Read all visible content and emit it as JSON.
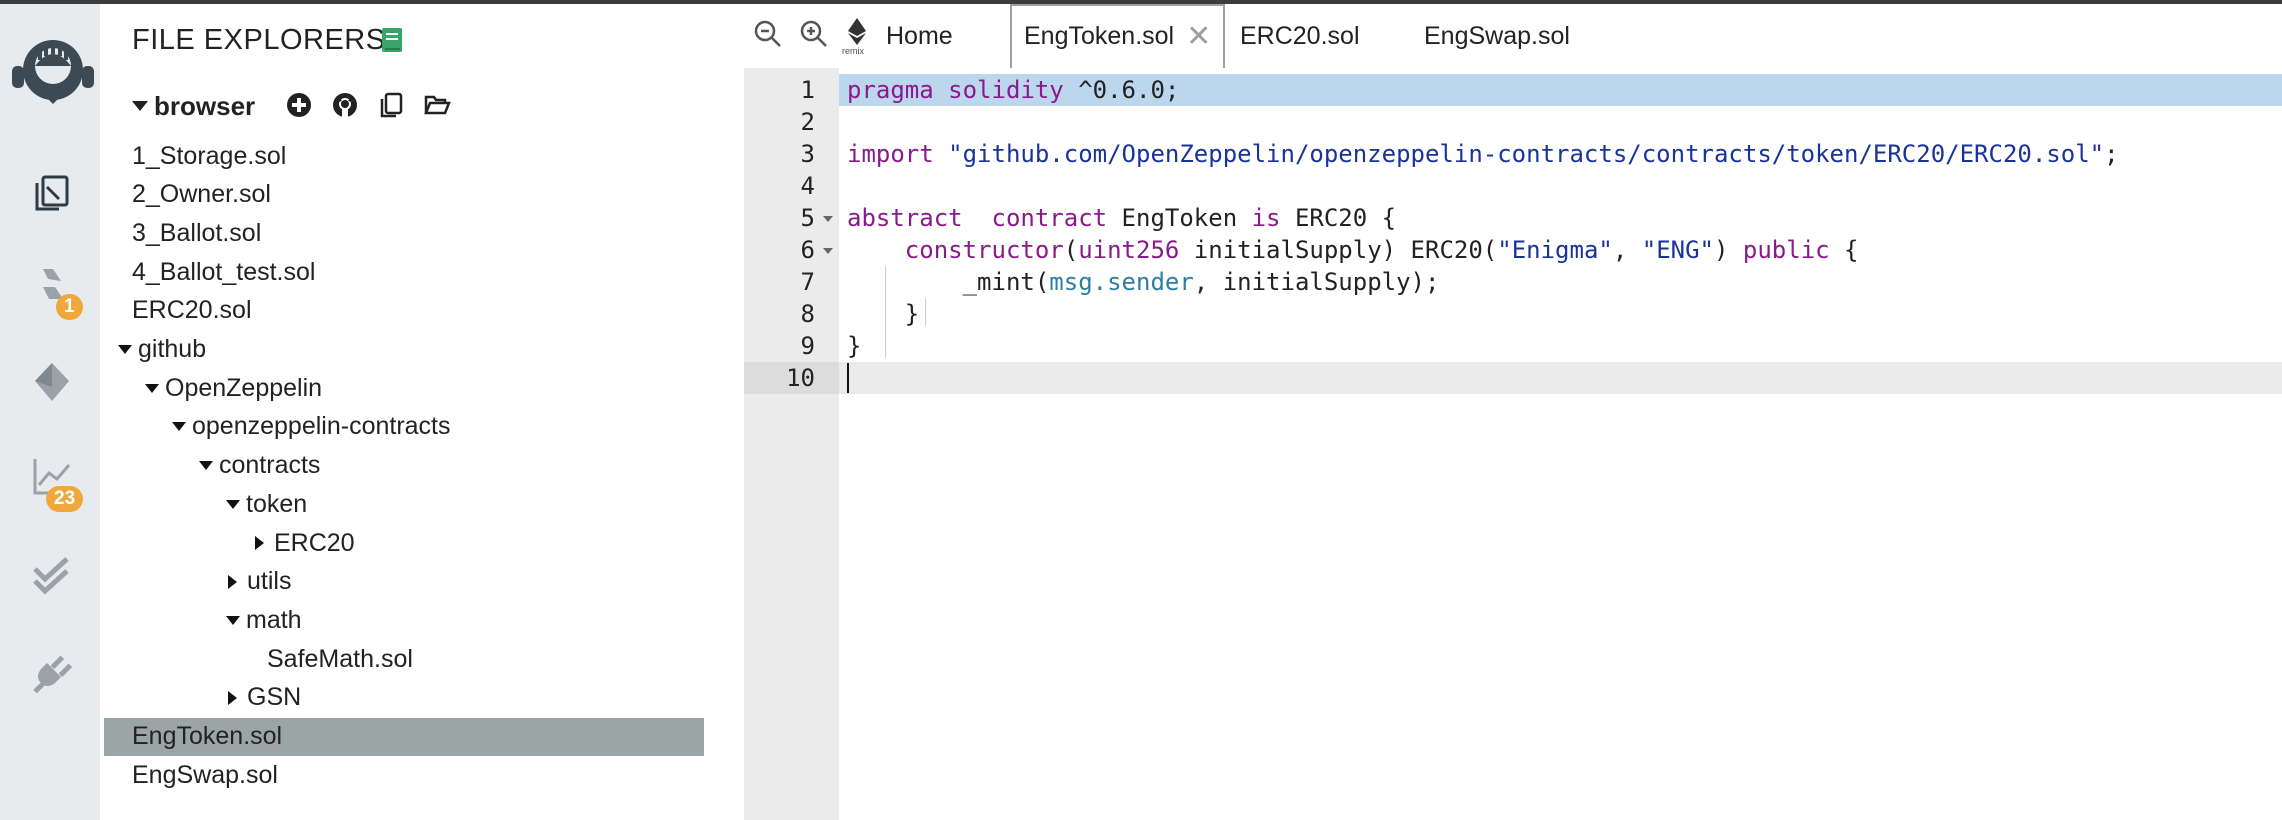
{
  "rail": {
    "badges": {
      "git": "1",
      "analysis": "23"
    }
  },
  "explorer": {
    "title": "FILE EXPLORERS",
    "workspace": "browser",
    "tree": [
      {
        "label": "1_Storage.sol",
        "depth": 0,
        "type": "file"
      },
      {
        "label": "2_Owner.sol",
        "depth": 0,
        "type": "file"
      },
      {
        "label": "3_Ballot.sol",
        "depth": 0,
        "type": "file"
      },
      {
        "label": "4_Ballot_test.sol",
        "depth": 0,
        "type": "file"
      },
      {
        "label": "ERC20.sol",
        "depth": 0,
        "type": "file"
      },
      {
        "label": "github",
        "depth": 0,
        "type": "folder-open"
      },
      {
        "label": "OpenZeppelin",
        "depth": 1,
        "type": "folder-open"
      },
      {
        "label": "openzeppelin-contracts",
        "depth": 2,
        "type": "folder-open"
      },
      {
        "label": "contracts",
        "depth": 3,
        "type": "folder-open"
      },
      {
        "label": "token",
        "depth": 4,
        "type": "folder-open"
      },
      {
        "label": "ERC20",
        "depth": 5,
        "type": "folder-closed"
      },
      {
        "label": "utils",
        "depth": 4,
        "type": "folder-closed"
      },
      {
        "label": "math",
        "depth": 4,
        "type": "folder-open"
      },
      {
        "label": "SafeMath.sol",
        "depth": 5,
        "type": "file"
      },
      {
        "label": "GSN",
        "depth": 4,
        "type": "folder-closed"
      },
      {
        "label": "EngToken.sol",
        "depth": 0,
        "type": "file",
        "selected": true
      },
      {
        "label": "EngSwap.sol",
        "depth": 0,
        "type": "file"
      }
    ]
  },
  "tabs": {
    "home_label": "Home",
    "home_sublabel": "remix",
    "active_label": "EngToken.sol",
    "close_glyph": "✕",
    "other": [
      "ERC20.sol",
      "EngSwap.sol"
    ]
  },
  "editor": {
    "line_numbers": [
      "1",
      "2",
      "3",
      "4",
      "5",
      "6",
      "7",
      "8",
      "9",
      "10"
    ],
    "highlighted_line": 1,
    "current_line": 10,
    "lines": [
      [
        {
          "t": "pragma",
          "c": "kw"
        },
        {
          "t": " "
        },
        {
          "t": "solidity",
          "c": "kw"
        },
        {
          "t": " ^0.6.0;"
        }
      ],
      [],
      [
        {
          "t": "import",
          "c": "kw"
        },
        {
          "t": " "
        },
        {
          "t": "\"github.com/OpenZeppelin/openzeppelin-contracts/contracts/token/ERC20/ERC20.sol\"",
          "c": "str"
        },
        {
          "t": ";"
        }
      ],
      [],
      [
        {
          "t": "abstract",
          "c": "kw"
        },
        {
          "t": "  "
        },
        {
          "t": "contract",
          "c": "kw"
        },
        {
          "t": " EngToken "
        },
        {
          "t": "is",
          "c": "kw"
        },
        {
          "t": " ERC20 {"
        }
      ],
      [
        {
          "t": "    "
        },
        {
          "t": "constructor",
          "c": "kw"
        },
        {
          "t": "("
        },
        {
          "t": "uint256",
          "c": "ty"
        },
        {
          "t": " initialSupply) ERC20("
        },
        {
          "t": "\"Enigma\"",
          "c": "str"
        },
        {
          "t": ", "
        },
        {
          "t": "\"ENG\"",
          "c": "str"
        },
        {
          "t": ") "
        },
        {
          "t": "public",
          "c": "kw"
        },
        {
          "t": " {"
        }
      ],
      [
        {
          "t": "        _mint("
        },
        {
          "t": "msg.sender",
          "c": "mem"
        },
        {
          "t": ", initialSupply);"
        }
      ],
      [
        {
          "t": "    }"
        }
      ],
      [
        {
          "t": "}"
        }
      ],
      []
    ]
  }
}
